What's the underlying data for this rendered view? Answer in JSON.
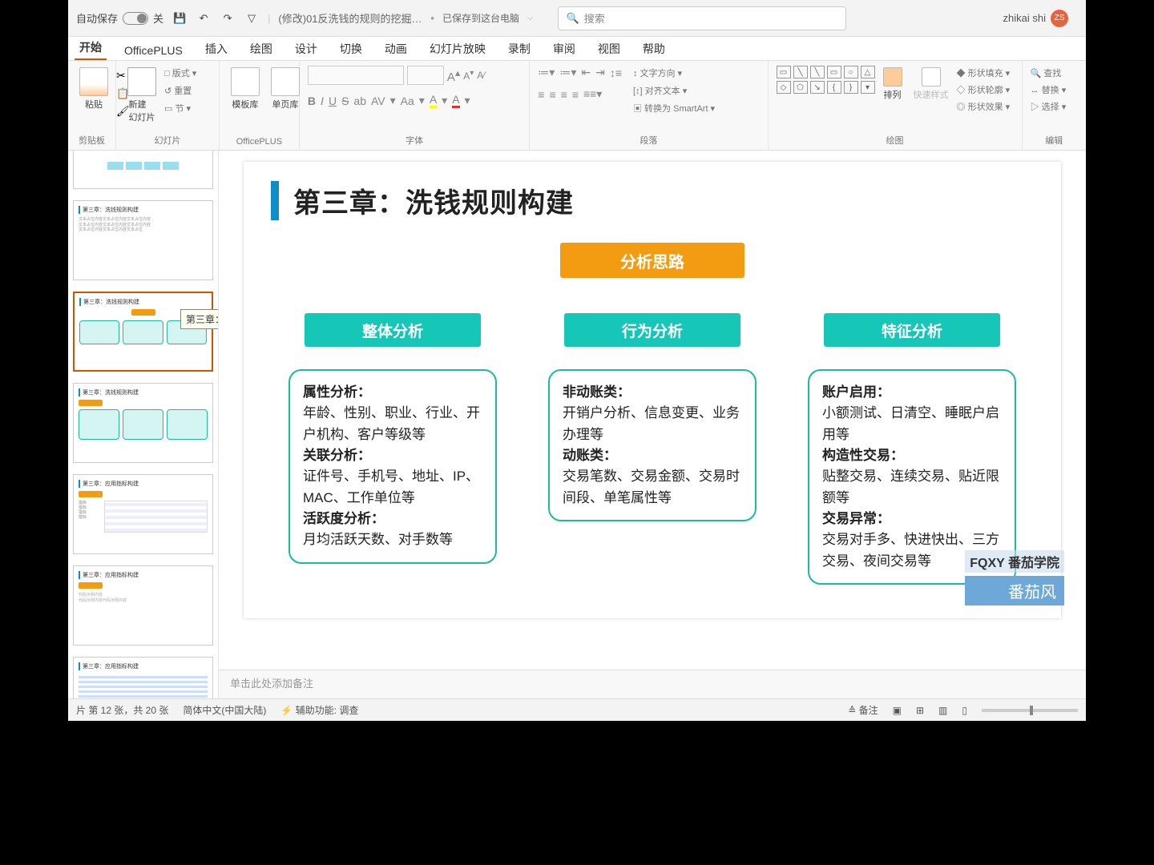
{
  "titlebar": {
    "autosave_label": "自动保存",
    "autosave_state": "关",
    "filename": "(修改)01反洗钱的规则的挖掘.p…",
    "saved_status": "已保存到这台电脑",
    "search_placeholder": "搜索",
    "username": "zhikai shi",
    "avatar_initials": "ZS"
  },
  "tabs": [
    "开始",
    "OfficePLUS",
    "插入",
    "绘图",
    "设计",
    "切换",
    "动画",
    "幻灯片放映",
    "录制",
    "审阅",
    "视图",
    "帮助"
  ],
  "ribbon": {
    "clipboard": {
      "paste": "粘贴",
      "group": "剪贴板"
    },
    "slides": {
      "new": "新建\n幻灯片",
      "layout": "版式",
      "reset": "重置",
      "section": "节",
      "group": "幻灯片"
    },
    "officeplus": {
      "a": "模板库",
      "b": "单页库",
      "group": "OfficePLUS"
    },
    "font": {
      "group": "字体",
      "bold": "B",
      "italic": "I",
      "underline": "U",
      "strike": "S",
      "av": "AV",
      "aa": "Aa",
      "inc": "A",
      "dec": "A"
    },
    "paragraph": {
      "group": "段落",
      "text_direction": "文字方向",
      "align_text": "对齐文本",
      "to_smartart": "转换为 SmartArt"
    },
    "drawing": {
      "group": "绘图",
      "arrange": "排列",
      "quick": "快速样式",
      "fill": "形状填充",
      "outline": "形状轮廓",
      "effects": "形状效果"
    },
    "editing": {
      "group": "编辑",
      "find": "查找",
      "replace": "替换",
      "select": "选择"
    }
  },
  "tooltip": "第三章：洗钱规则构建",
  "slide": {
    "title": "第三章：洗钱规则构建",
    "analysis_btn": "分析思路",
    "cols": [
      {
        "head": "整体分析",
        "body": "<b>属性分析：</b><br>年龄、性别、职业、行业、开户机构、客户等级等<br><b>关联分析：</b><br>证件号、手机号、地址、IP、MAC、工作单位等<br><b>活跃度分析：</b><br>月均活跃天数、对手数等"
      },
      {
        "head": "行为分析",
        "body": "<b>非动账类：</b><br>开销户分析、信息变更、业务办理等<br><b>动账类：</b><br>交易笔数、交易金额、交易时间段、单笔属性等"
      },
      {
        "head": "特征分析",
        "body": "<b>账户启用：</b><br>小额测试、日清空、睡眠户启用等<br><b>构造性交易：</b><br>贴整交易、连续交易、贴近限额等<br><b>交易异常：</b><br>交易对手多、快进快出、三方交易、夜间交易等"
      }
    ],
    "watermark1": "FQXY 番茄学院",
    "watermark2": "番茄风"
  },
  "notes_placeholder": "单击此处添加备注",
  "status": {
    "slide_info": "片 第 12 张，共 20 张",
    "lang": "简体中文(中国大陆)",
    "access": "辅助功能: 调查",
    "notes_btn": "备注"
  }
}
